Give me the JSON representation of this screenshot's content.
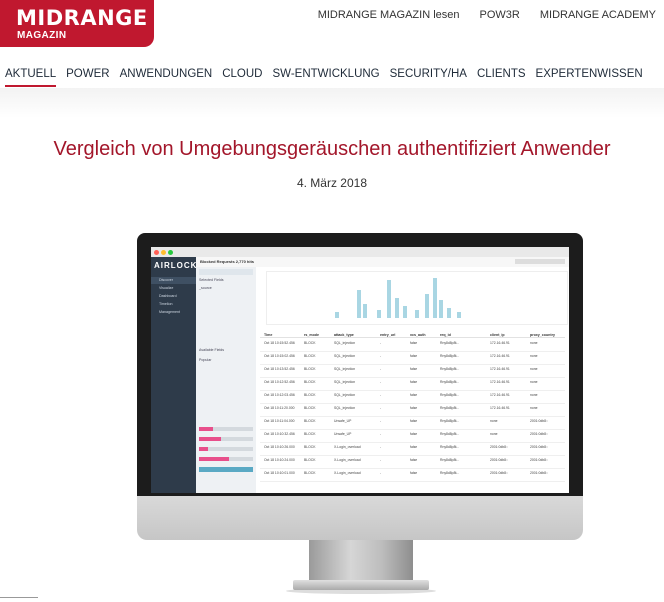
{
  "brand": {
    "name": "MIDRANGE",
    "sub": "MAGAZIN",
    "color": "#c0182f"
  },
  "top_links": [
    "MIDRANGE MAGAZIN lesen",
    "POW3R",
    "MIDRANGE ACADEMY"
  ],
  "nav": [
    "AKTUELL",
    "POWER",
    "ANWENDUNGEN",
    "CLOUD",
    "SW-ENTWICKLUNG",
    "SECURITY/HA",
    "CLIENTS",
    "EXPERTENWISSEN"
  ],
  "article": {
    "title": "Vergleich von Umgebungsgeräuschen authentifiziert Anwender",
    "date": "4. März 2018"
  },
  "screen": {
    "logo": "AIRLOCK",
    "sidebar": [
      "Discover",
      "Visualize",
      "Dashboard",
      "Timelion",
      "Management"
    ],
    "toolbar_title": "Blocked Requests 2,770 hits",
    "fields": [
      "Selected Fields",
      "_source",
      "Available Fields",
      "Popular"
    ],
    "columns": [
      "Time",
      "rs_mode",
      "attack_type",
      "entry_url",
      "xcs_auth",
      "req_id",
      "client_ip",
      "proxy_country"
    ],
    "rows": [
      [
        "Oct 18 10:15:52.456",
        "BLOCK",
        "SQL_injection",
        "-",
        "false",
        "Rny8d8p8t...",
        "172.16.46.91",
        "none"
      ],
      [
        "Oct 18 10:15:02.456",
        "BLOCK",
        "SQL_injection",
        "-",
        "false",
        "Rny8d8p8t...",
        "172.16.46.91",
        "none"
      ],
      [
        "Oct 18 10:13:52.456",
        "BLOCK",
        "SQL_injection",
        "-",
        "false",
        "Rny8d8p8t...",
        "172.16.46.91",
        "none"
      ],
      [
        "Oct 18 10:12:52.456",
        "BLOCK",
        "SQL_injection",
        "-",
        "false",
        "Rny8d8p8t...",
        "172.16.46.91",
        "none"
      ],
      [
        "Oct 18 10:12:03.456",
        "BLOCK",
        "SQL_injection",
        "-",
        "false",
        "Rny8d8p8t...",
        "172.16.46.91",
        "none"
      ],
      [
        "Oct 18 10:11:20.000",
        "BLOCK",
        "SQL_injection",
        "-",
        "false",
        "Rny8d8p8t...",
        "172.16.46.91",
        "none"
      ],
      [
        "Oct 18 10:11:04.000",
        "BLOCK",
        "Unsafe_UP",
        "-",
        "false",
        "Rny8d8p8t...",
        "none",
        "2001:0db8::"
      ],
      [
        "Oct 18 10:10:32.456",
        "BLOCK",
        "Unsafe_UP",
        "-",
        "false",
        "Rny8d8p8t...",
        "none",
        "2001:0db8::"
      ],
      [
        "Oct 18 10:10:26.000",
        "BLOCK",
        "X-Login_overload",
        "-",
        "false",
        "Rny8d8p8t...",
        "2001:0db8::",
        "2001:0db8::"
      ],
      [
        "Oct 18 10:10:24.000",
        "BLOCK",
        "X-Login_overload",
        "-",
        "false",
        "Rny8d8p8t...",
        "2001:0db8::",
        "2001:0db8::"
      ],
      [
        "Oct 18 10:10:01.000",
        "BLOCK",
        "X-Login_overload",
        "-",
        "false",
        "Rny8d8p8t...",
        "2001:0db8::",
        "2001:0db8::"
      ]
    ]
  }
}
